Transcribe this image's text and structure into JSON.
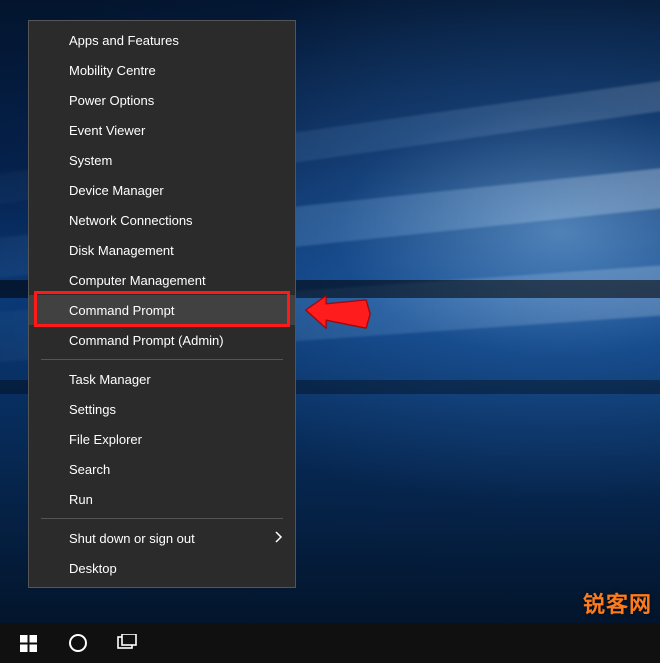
{
  "menu": {
    "groups": [
      [
        {
          "id": "apps-features",
          "label": "Apps and Features"
        },
        {
          "id": "mobility-centre",
          "label": "Mobility Centre"
        },
        {
          "id": "power-options",
          "label": "Power Options"
        },
        {
          "id": "event-viewer",
          "label": "Event Viewer"
        },
        {
          "id": "system",
          "label": "System"
        },
        {
          "id": "device-manager",
          "label": "Device Manager"
        },
        {
          "id": "network-connections",
          "label": "Network Connections"
        },
        {
          "id": "disk-management",
          "label": "Disk Management"
        },
        {
          "id": "computer-management",
          "label": "Computer Management"
        },
        {
          "id": "command-prompt",
          "label": "Command Prompt",
          "highlighted": true
        },
        {
          "id": "command-prompt-admin",
          "label": "Command Prompt (Admin)"
        }
      ],
      [
        {
          "id": "task-manager",
          "label": "Task Manager"
        },
        {
          "id": "settings",
          "label": "Settings"
        },
        {
          "id": "file-explorer",
          "label": "File Explorer"
        },
        {
          "id": "search",
          "label": "Search"
        },
        {
          "id": "run",
          "label": "Run"
        }
      ],
      [
        {
          "id": "shutdown-signout",
          "label": "Shut down or sign out",
          "submenu": true
        },
        {
          "id": "desktop",
          "label": "Desktop"
        }
      ]
    ]
  },
  "watermark": "锐客网",
  "colors": {
    "highlight": "#ff1a1a",
    "menu_bg": "#2b2b2b",
    "menu_hover": "#414141"
  }
}
